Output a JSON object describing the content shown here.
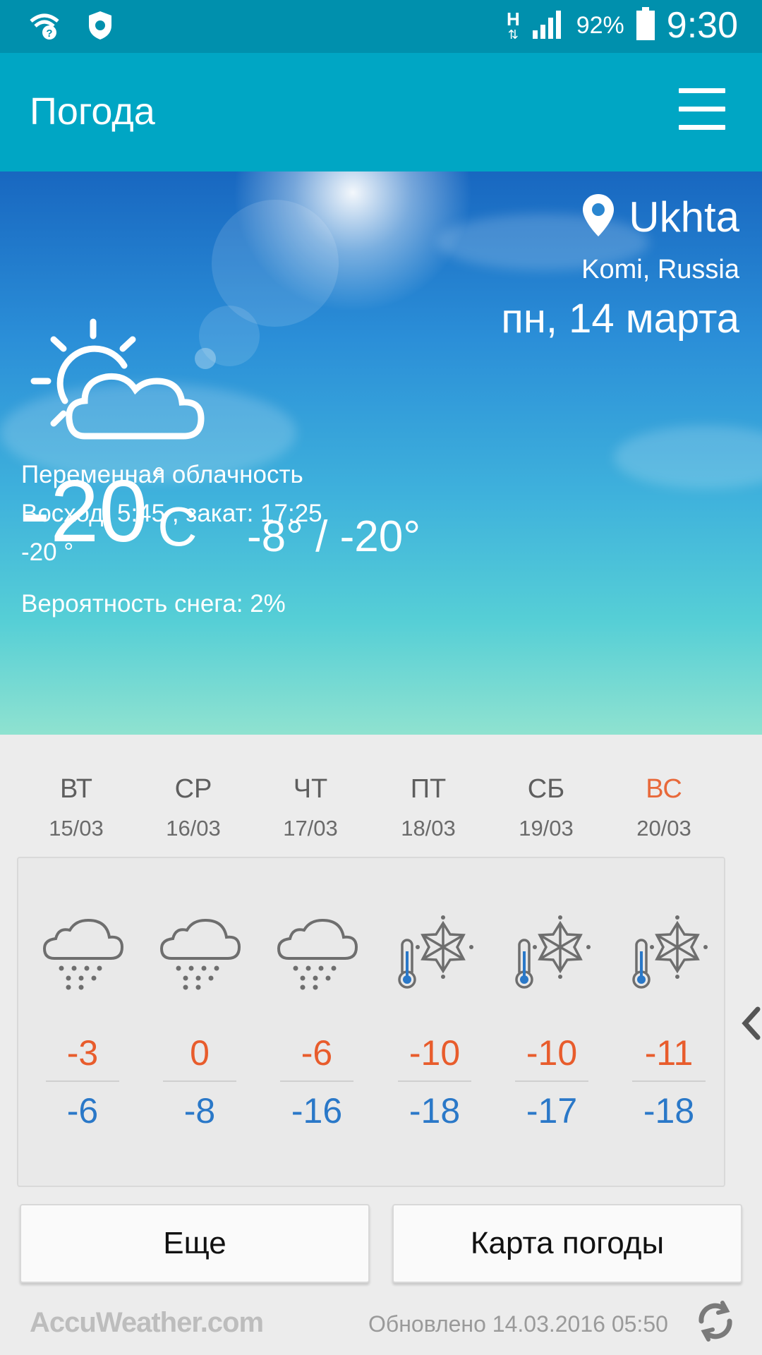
{
  "status_bar": {
    "network_label": "H",
    "battery": "92%",
    "time": "9:30",
    "icons": [
      "wifi-question-icon",
      "security-icon",
      "data-arrows-icon",
      "signal-icon",
      "battery-icon"
    ]
  },
  "app_bar": {
    "title": "Погода",
    "menu_icon": "hamburger-menu-icon"
  },
  "current": {
    "city": "Ukhta",
    "region": "Komi, Russia",
    "date": "пн, 14 марта",
    "condition_icon": "partly-cloudy-sun-icon",
    "temperature": "-20",
    "degree_symbol": "°",
    "unit": "C",
    "high_low": "-8° / -20°",
    "description": "Переменная облачность",
    "sun_times": "Восход: 5:45 , закат: 17:25",
    "feels_like": "-20 °",
    "snow_chance": "Вероятность снега: 2%"
  },
  "forecast": [
    {
      "day": "ВТ",
      "date": "15/03",
      "icon": "cloud-snow-icon",
      "high": "-3",
      "low": "-6"
    },
    {
      "day": "СР",
      "date": "16/03",
      "icon": "cloud-snow-icon",
      "high": "0",
      "low": "-8"
    },
    {
      "day": "ЧТ",
      "date": "17/03",
      "icon": "cloud-snow-icon",
      "high": "-6",
      "low": "-16"
    },
    {
      "day": "ПТ",
      "date": "18/03",
      "icon": "snowflake-thermometer-icon",
      "high": "-10",
      "low": "-18"
    },
    {
      "day": "СБ",
      "date": "19/03",
      "icon": "snowflake-thermometer-icon",
      "high": "-10",
      "low": "-17"
    },
    {
      "day": "ВС",
      "date": "20/03",
      "icon": "snowflake-thermometer-icon",
      "high": "-11",
      "low": "-18"
    }
  ],
  "colors": {
    "statusbar": "#0090ad",
    "appbar": "#00a6c4",
    "high_temp": "#e85c2c",
    "low_temp": "#2a78c8",
    "weekend_day": "#e8693a"
  },
  "buttons": {
    "more": "Еще",
    "weather_map": "Карта погоды"
  },
  "footer": {
    "brand": "AccuWeather.com",
    "updated": "Обновлено 14.03.2016 05:50",
    "refresh_icon": "refresh-icon"
  }
}
